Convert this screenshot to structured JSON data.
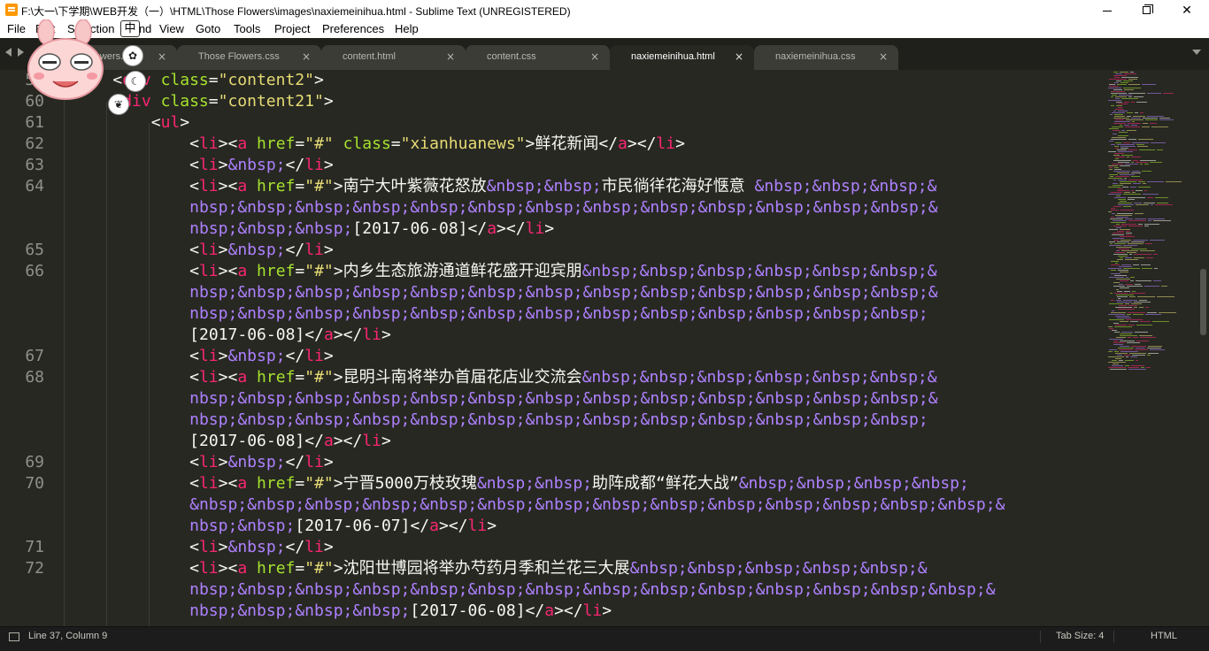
{
  "window": {
    "title": "F:\\大一\\下学期\\WEB开发（一）\\HTML\\Those Flowers\\images\\naxiemeinihua.html - Sublime Text (UNREGISTERED)"
  },
  "menu": [
    "File",
    "Edit",
    "Selection",
    "Find",
    "View",
    "Goto",
    "Tools",
    "Project",
    "Preferences",
    "Help"
  ],
  "ime": {
    "label": "中"
  },
  "tabs": [
    {
      "label": "Those Flowers.html",
      "active": false
    },
    {
      "label": "Those Flowers.css",
      "active": false
    },
    {
      "label": "content.html",
      "active": false
    },
    {
      "label": "content.css",
      "active": false
    },
    {
      "label": "naxiemeinihua.html",
      "active": true
    },
    {
      "label": "naxiemeinihua.css",
      "active": false
    }
  ],
  "tab_close_glyph": "×",
  "editor": {
    "line_numbers": [
      "59",
      "60",
      "61",
      "62",
      "63",
      "64",
      "",
      "",
      "65",
      "66",
      "",
      "",
      "",
      "67",
      "68",
      "",
      "",
      "",
      "69",
      "70",
      "",
      "",
      "71",
      "72",
      "",
      ""
    ],
    "lines": [
      {
        "indent": 0,
        "text": "    <div class=\"content2\">"
      },
      {
        "indent": 0,
        "text": "    <div class=\"content21\">"
      },
      {
        "indent": 0,
        "text": "        <ul>"
      },
      {
        "indent": 0,
        "text": "            <li><a href=\"#\" class=\"xianhuanews\">鲜花新闻</a></li>"
      },
      {
        "indent": 0,
        "text": "            <li>&nbsp;</li>"
      },
      {
        "indent": 0,
        "text": "            <li><a href=\"#\">南宁大叶紫薇花怒放&nbsp;&nbsp;市民徜徉花海好惬意 &nbsp;&nbsp;&nbsp;&"
      },
      {
        "indent": 0,
        "text": "            nbsp;&nbsp;&nbsp;&nbsp;&nbsp;&nbsp;&nbsp;&nbsp;&nbsp;&nbsp;&nbsp;&nbsp;&nbsp;&"
      },
      {
        "indent": 0,
        "text": "            nbsp;&nbsp;&nbsp;[2017-06-08]</a></li>"
      },
      {
        "indent": 0,
        "text": "            <li>&nbsp;</li>"
      },
      {
        "indent": 0,
        "text": "            <li><a href=\"#\">内乡生态旅游通道鲜花盛开迎宾朋&nbsp;&nbsp;&nbsp;&nbsp;&nbsp;&nbsp;&"
      },
      {
        "indent": 0,
        "text": "            nbsp;&nbsp;&nbsp;&nbsp;&nbsp;&nbsp;&nbsp;&nbsp;&nbsp;&nbsp;&nbsp;&nbsp;&nbsp;&"
      },
      {
        "indent": 0,
        "text": "            nbsp;&nbsp;&nbsp;&nbsp;&nbsp;&nbsp;&nbsp;&nbsp;&nbsp;&nbsp;&nbsp;&nbsp;&nbsp;"
      },
      {
        "indent": 0,
        "text": "            [2017-06-08]</a></li>"
      },
      {
        "indent": 0,
        "text": "            <li>&nbsp;</li>"
      },
      {
        "indent": 0,
        "text": "            <li><a href=\"#\">昆明斗南将举办首届花店业交流会&nbsp;&nbsp;&nbsp;&nbsp;&nbsp;&nbsp;&"
      },
      {
        "indent": 0,
        "text": "            nbsp;&nbsp;&nbsp;&nbsp;&nbsp;&nbsp;&nbsp;&nbsp;&nbsp;&nbsp;&nbsp;&nbsp;&nbsp;&"
      },
      {
        "indent": 0,
        "text": "            nbsp;&nbsp;&nbsp;&nbsp;&nbsp;&nbsp;&nbsp;&nbsp;&nbsp;&nbsp;&nbsp;&nbsp;&nbsp;"
      },
      {
        "indent": 0,
        "text": "            [2017-06-08]</a></li>"
      },
      {
        "indent": 0,
        "text": "            <li>&nbsp;</li>"
      },
      {
        "indent": 0,
        "text": "            <li><a href=\"#\">宁晋5000万枝玫瑰&nbsp;&nbsp;助阵成都“鲜花大战”&nbsp;&nbsp;&nbsp;&nbsp;"
      },
      {
        "indent": 0,
        "text": "            &nbsp;&nbsp;&nbsp;&nbsp;&nbsp;&nbsp;&nbsp;&nbsp;&nbsp;&nbsp;&nbsp;&nbsp;&nbsp;&nbsp;&"
      },
      {
        "indent": 0,
        "text": "            nbsp;&nbsp;[2017-06-07]</a></li>"
      },
      {
        "indent": 0,
        "text": "            <li>&nbsp;</li>"
      },
      {
        "indent": 0,
        "text": "            <li><a href=\"#\">沈阳世博园将举办芍药月季和兰花三大展&nbsp;&nbsp;&nbsp;&nbsp;&nbsp;&"
      },
      {
        "indent": 0,
        "text": "            nbsp;&nbsp;&nbsp;&nbsp;&nbsp;&nbsp;&nbsp;&nbsp;&nbsp;&nbsp;&nbsp;&nbsp;&nbsp;&nbsp;&"
      },
      {
        "indent": 0,
        "text": "            nbsp;&nbsp;&nbsp;&nbsp;[2017-06-08]</a></li>"
      }
    ]
  },
  "status": {
    "position": "Line 37, Column 9",
    "tab_size": "Tab Size: 4",
    "syntax": "HTML"
  },
  "colors": {
    "background": "#272822",
    "tag": "#f92672",
    "attribute": "#a6e22e",
    "string": "#e6db74",
    "entity": "#ae81ff",
    "text": "#f8f8f2",
    "line_number": "#8f908a"
  }
}
